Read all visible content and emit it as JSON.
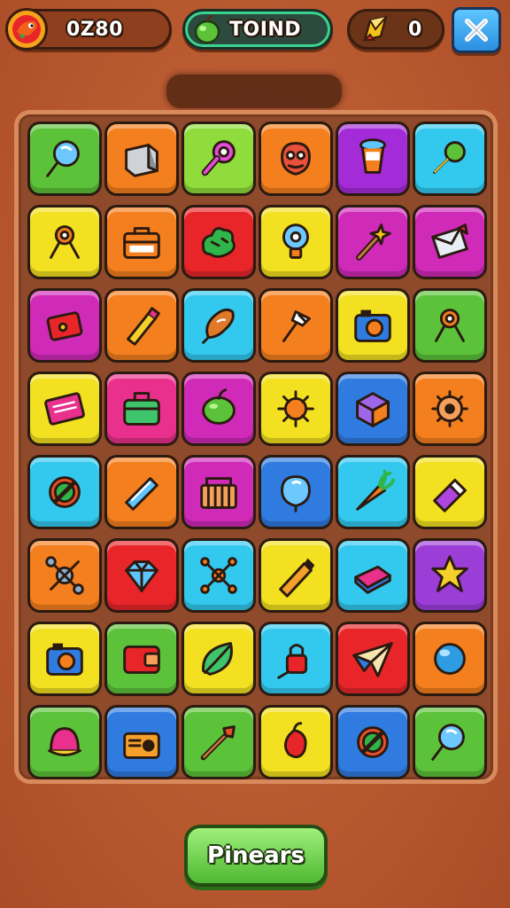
{
  "hud": {
    "score": {
      "value": "0Z80",
      "icon": "dragon-head-icon"
    },
    "moves": {
      "value": "TOIND",
      "icon": "green-apple-icon"
    },
    "coins": {
      "value": "0",
      "icon": "gold-pencil-icon"
    },
    "close": {
      "icon": "close-icon"
    }
  },
  "board": {
    "colors": {
      "green": "#5cc23a",
      "orange": "#f47f1e",
      "lime": "#8fdc3c",
      "purple": "#a42cd8",
      "cyan": "#33c8ee",
      "yellow": "#f2e021",
      "red": "#e8262a",
      "magenta": "#cf2ab8",
      "blue": "#2f7be0",
      "pink": "#e8308c",
      "violet": "#9b3ed8"
    },
    "rows": [
      [
        {
          "color": "green",
          "icon": "lollipop-icon"
        },
        {
          "color": "orange",
          "icon": "box-icon"
        },
        {
          "color": "lime",
          "icon": "hairdryer-icon"
        },
        {
          "color": "orange",
          "icon": "monster-face-icon"
        },
        {
          "color": "purple",
          "icon": "cup-icon"
        },
        {
          "color": "cyan",
          "icon": "magnifier-icon"
        }
      ],
      [
        {
          "color": "yellow",
          "icon": "target-stand-icon"
        },
        {
          "color": "orange",
          "icon": "toolbox-icon"
        },
        {
          "color": "red",
          "icon": "green-blob-icon"
        },
        {
          "color": "yellow",
          "icon": "lightbulb-icon"
        },
        {
          "color": "magenta",
          "icon": "magic-wand-icon"
        },
        {
          "color": "magenta",
          "icon": "envelope-icon"
        }
      ],
      [
        {
          "color": "magenta",
          "icon": "red-card-icon"
        },
        {
          "color": "orange",
          "icon": "pen-icon"
        },
        {
          "color": "cyan",
          "icon": "drumstick-icon"
        },
        {
          "color": "orange",
          "icon": "flag-icon"
        },
        {
          "color": "yellow",
          "icon": "camera-icon"
        },
        {
          "color": "green",
          "icon": "target-stand-icon"
        }
      ],
      [
        {
          "color": "yellow",
          "icon": "book-icon"
        },
        {
          "color": "pink",
          "icon": "lunchbox-icon"
        },
        {
          "color": "magenta",
          "icon": "apple-icon"
        },
        {
          "color": "yellow",
          "icon": "virus-icon"
        },
        {
          "color": "blue",
          "icon": "crate-icon"
        },
        {
          "color": "orange",
          "icon": "gear-target-icon"
        }
      ],
      [
        {
          "color": "cyan",
          "icon": "no-sign-icon"
        },
        {
          "color": "orange",
          "icon": "blue-bar-icon"
        },
        {
          "color": "magenta",
          "icon": "basket-icon"
        },
        {
          "color": "blue",
          "icon": "balloon-icon"
        },
        {
          "color": "cyan",
          "icon": "carrot-icon"
        },
        {
          "color": "yellow",
          "icon": "eraser-icon"
        }
      ],
      [
        {
          "color": "orange",
          "icon": "drone-icon"
        },
        {
          "color": "red",
          "icon": "gem-icon"
        },
        {
          "color": "cyan",
          "icon": "molecule-icon"
        },
        {
          "color": "yellow",
          "icon": "telescope-icon"
        },
        {
          "color": "cyan",
          "icon": "book-stack-icon"
        },
        {
          "color": "violet",
          "icon": "star-icon"
        }
      ],
      [
        {
          "color": "yellow",
          "icon": "camera-icon"
        },
        {
          "color": "green",
          "icon": "wallet-icon"
        },
        {
          "color": "yellow",
          "icon": "leaf-icon"
        },
        {
          "color": "cyan",
          "icon": "lock-icon"
        },
        {
          "color": "red",
          "icon": "paper-plane-icon"
        },
        {
          "color": "orange",
          "icon": "blue-orb-icon"
        }
      ],
      [
        {
          "color": "green",
          "icon": "hat-icon"
        },
        {
          "color": "blue",
          "icon": "radio-icon"
        },
        {
          "color": "green",
          "icon": "spear-icon"
        },
        {
          "color": "yellow",
          "icon": "pepper-icon"
        },
        {
          "color": "blue",
          "icon": "no-sign-icon"
        },
        {
          "color": "green",
          "icon": "lollipop-icon"
        }
      ]
    ]
  },
  "actions": {
    "primary_label": "Pinears"
  }
}
